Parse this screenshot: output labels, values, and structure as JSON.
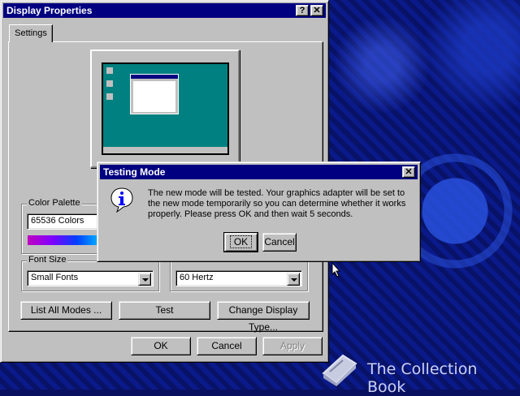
{
  "window": {
    "title": "Display Properties",
    "help_label": "?",
    "close_label": "✕",
    "tab_settings": "Settings"
  },
  "color_palette": {
    "label": "Color Palette",
    "value": "65536 Colors"
  },
  "font_size": {
    "label": "Font Size",
    "value": "Small Fonts"
  },
  "refresh_rate": {
    "value": "60 Hertz"
  },
  "buttons": {
    "list_modes": "List All Modes ...",
    "test": "Test",
    "change_display_type": "Change Display Type...",
    "ok": "OK",
    "cancel": "Cancel",
    "apply": "Apply"
  },
  "dialog": {
    "title": "Testing Mode",
    "close_label": "✕",
    "message": "The new mode will be tested. Your graphics adapter will be set to the new mode temporarily so you can determine whether it works properly. Please press OK and then wait 5 seconds.",
    "ok_label": "OK",
    "cancel_label": "Cancel",
    "icon": "info-icon"
  },
  "watermark": {
    "text": "The Collection Book",
    "icon": "book-icon"
  },
  "colors": {
    "titlebar": "#000080",
    "face": "#c0c0c0",
    "desktop_preview": "#008080"
  }
}
